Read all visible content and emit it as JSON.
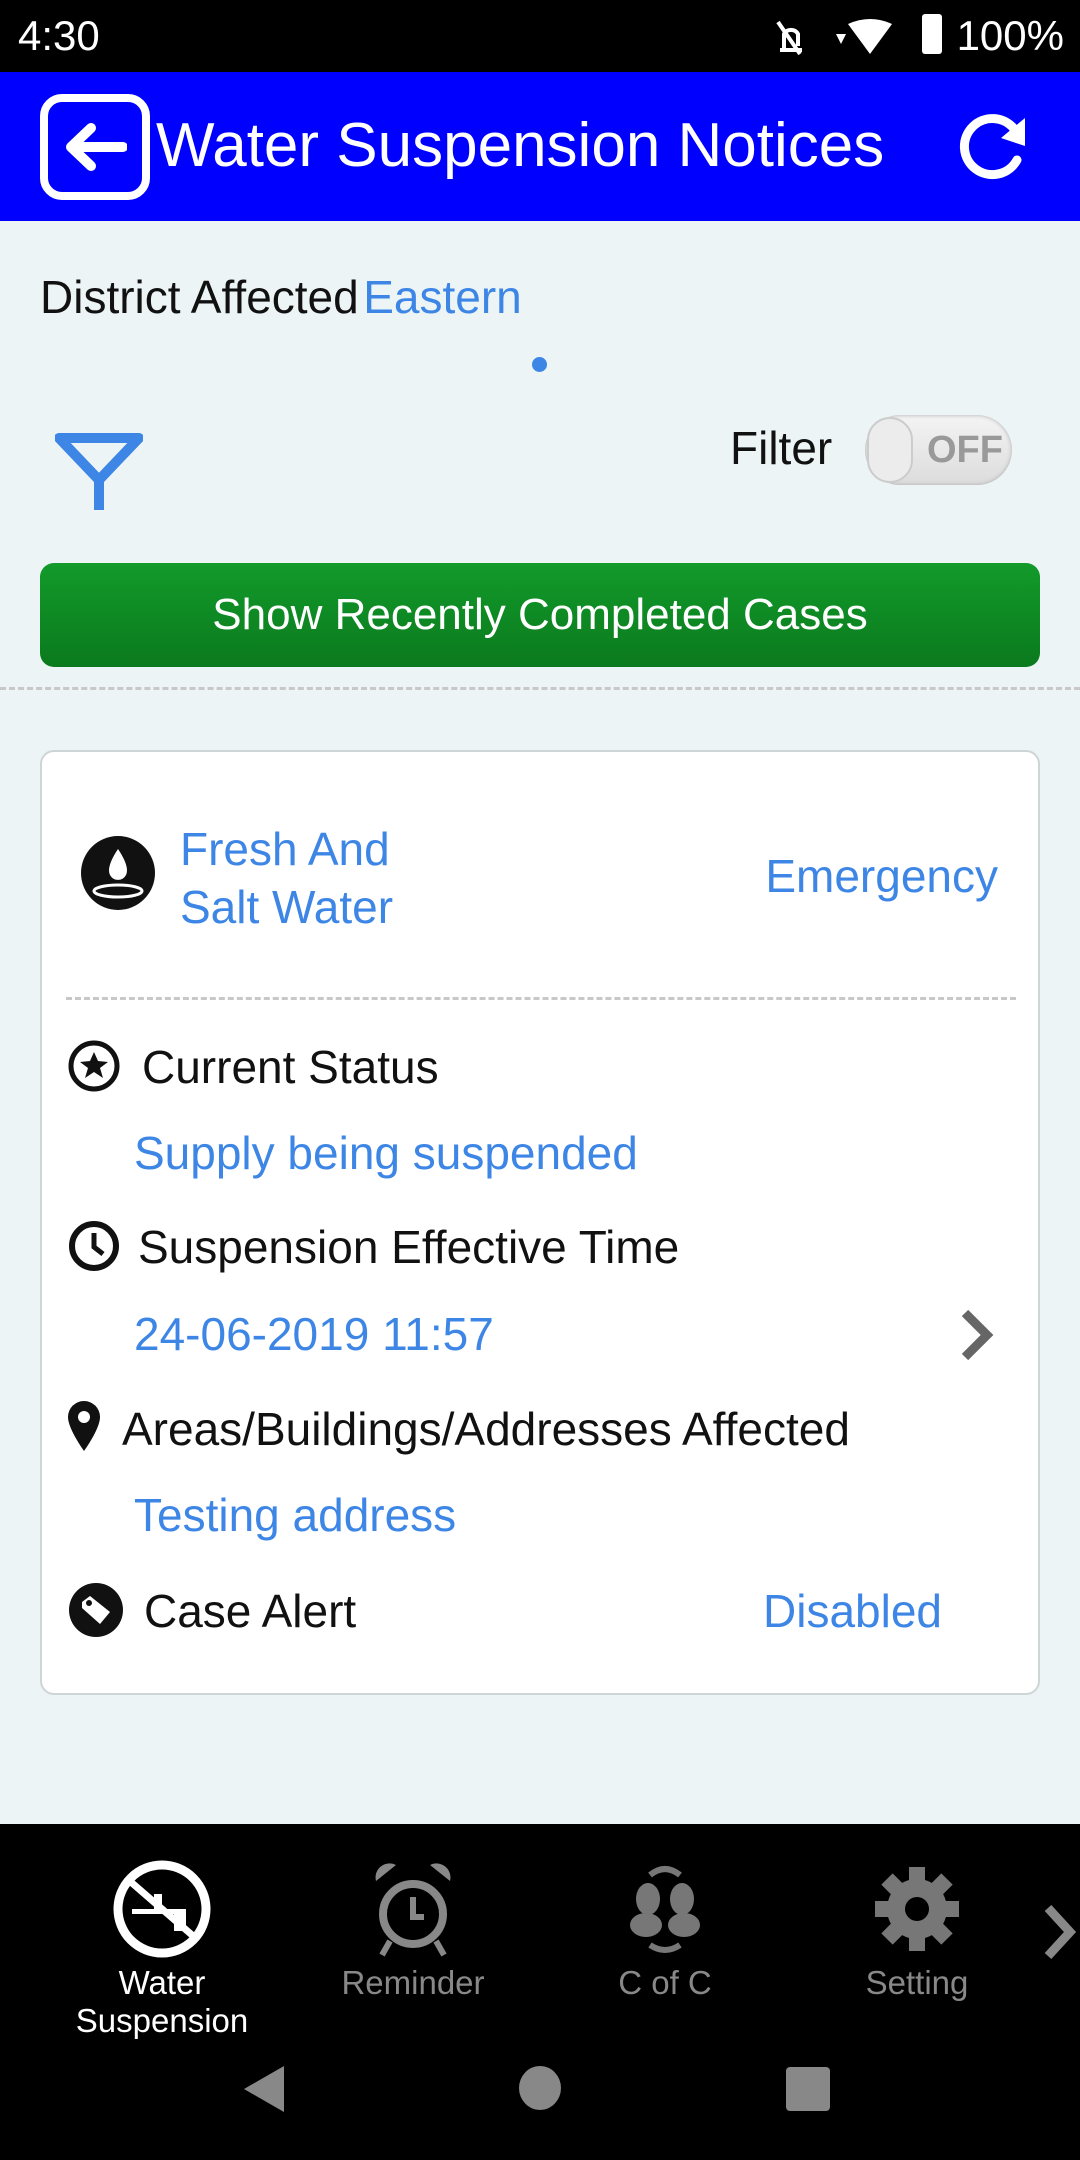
{
  "status_bar": {
    "time": "4:30",
    "battery": "100%"
  },
  "header": {
    "title": "Water Suspension Notices",
    "back_icon": "back-arrow-icon",
    "refresh_icon": "refresh-icon",
    "color": "#0000ff"
  },
  "district": {
    "label": "District Affected",
    "value": "Eastern"
  },
  "filter": {
    "label": "Filter",
    "toggle_state": "OFF"
  },
  "recent_button": {
    "label": "Show Recently Completed Cases",
    "color": "#0b8a24"
  },
  "card": {
    "type_line1": "Fresh And",
    "type_line2": "Salt Water",
    "priority": "Emergency",
    "status_label": "Current Status",
    "status_value": "Supply being suspended",
    "time_label": "Suspension Effective Time",
    "time_value": "24-06-2019 11:57",
    "areas_label": "Areas/Buildings/Addresses Affected",
    "areas_value": "Testing address",
    "alert_label": "Case Alert",
    "alert_value": "Disabled"
  },
  "bottom_nav": {
    "items": [
      {
        "label": "Water Suspension",
        "active": true
      },
      {
        "label": "Reminder"
      },
      {
        "label": "C of C"
      },
      {
        "label": "Setting"
      }
    ]
  }
}
